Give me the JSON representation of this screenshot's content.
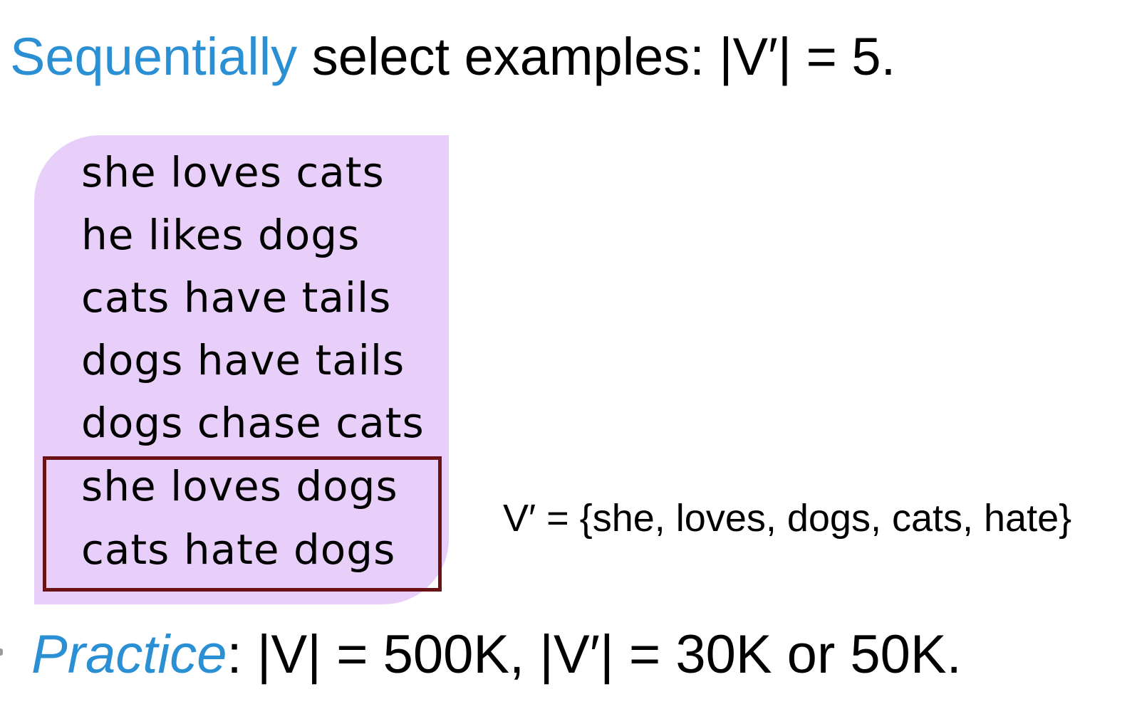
{
  "heading": {
    "accent_word": "Sequentially",
    "rest": " select examples: |V′| = 5."
  },
  "corpus": {
    "sentences": [
      "she loves cats",
      "he likes dogs",
      "cats have tails",
      "dogs have tails",
      "dogs chase cats",
      "she loves dogs",
      "cats hate dogs"
    ],
    "highlighted_indices": [
      5,
      6
    ]
  },
  "vocab_label": "V′ = {she, loves, dogs, cats, hate}",
  "practice": {
    "accent_word": "Practice",
    "rest": ": |V| = 500K, |V′| = 30K or 50K."
  },
  "colors": {
    "accent": "#2b8fd4",
    "box_fill": "#e8cffa",
    "frame": "#6b1216"
  }
}
